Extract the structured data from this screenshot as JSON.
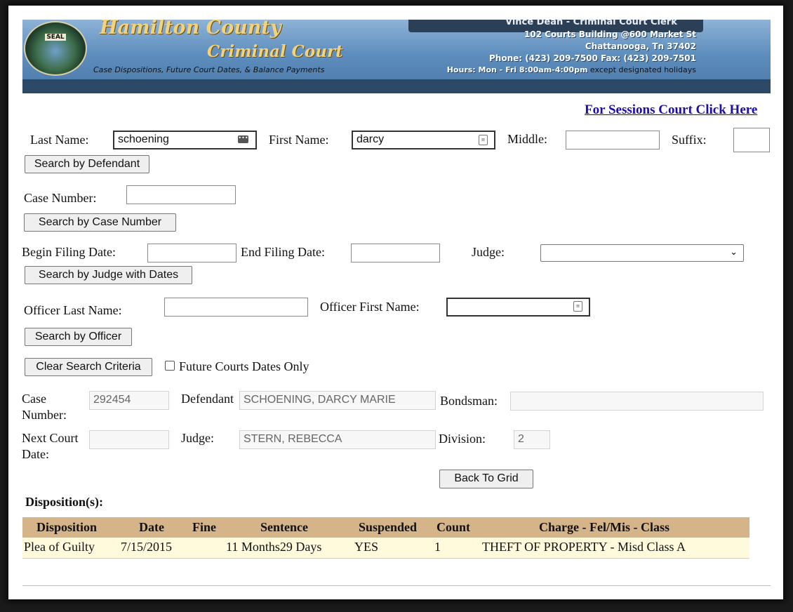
{
  "header": {
    "seal_text": "SEAL",
    "title_line1": "Hamilton County",
    "title_line2": "Criminal Court",
    "tagline": "Case Dispositions, Future Court Dates, & Balance Payments",
    "clerk": "Vince Dean - Criminal Court Clerk",
    "address1": "102 Courts Building @600 Market St",
    "address2": "Chattanooga, Tn 37402",
    "phone": "Phone: (423) 209-7500 Fax: (423) 209-7501",
    "hours": "Hours: Mon - Fri 8:00am-4:00pm",
    "hours_note": "except designated holidays"
  },
  "sessions_link": "For Sessions Court Click Here",
  "defendant_search": {
    "last_name_label": "Last Name:",
    "last_name_value": "schoening",
    "first_name_label": "First Name:",
    "first_name_value": "darcy",
    "middle_label": "Middle:",
    "middle_value": "",
    "suffix_label": "Suffix:",
    "suffix_value": "",
    "button": "Search by Defendant"
  },
  "case_search": {
    "label": "Case Number:",
    "value": "",
    "button": "Search by Case Number"
  },
  "judge_search": {
    "begin_label": "Begin Filing Date:",
    "begin_value": "",
    "end_label": "End Filing Date:",
    "end_value": "",
    "judge_label": "Judge:",
    "judge_selected": "",
    "button": "Search by Judge with Dates"
  },
  "officer_search": {
    "last_label": "Officer Last Name:",
    "last_value": "",
    "first_label": "Officer First Name:",
    "first_value": "",
    "button": "Search by Officer"
  },
  "clear_button": "Clear Search Criteria",
  "future_checkbox": {
    "label": "Future Courts Dates Only",
    "checked": false
  },
  "case_detail": {
    "case_number_label_1": "Case",
    "case_number_label_2": "Number:",
    "case_number": "292454",
    "defendant_label": "Defendant",
    "defendant": "SCHOENING, DARCY MARIE",
    "bondsman_label": "Bondsman:",
    "bondsman": "",
    "next_court_label_1": "Next Court",
    "next_court_label_2": "Date:",
    "next_court": "",
    "judge_label": "Judge:",
    "judge": "STERN, REBECCA",
    "division_label": "Division:",
    "division": "2",
    "back_button": "Back To Grid"
  },
  "dispositions": {
    "title": "Disposition(s):",
    "headers": [
      "Disposition",
      "Date",
      "Fine",
      "Sentence",
      "Suspended",
      "Count",
      "Charge - Fel/Mis - Class"
    ],
    "rows": [
      [
        "Plea of Guilty",
        "7/15/2015",
        "",
        "11 Months29 Days",
        "YES",
        "1",
        "THEFT OF PROPERTY - Misd Class A"
      ]
    ]
  },
  "colors": {
    "table_header": "#d5b48a",
    "table_row": "#fffadc",
    "link": "#1a0dab"
  }
}
